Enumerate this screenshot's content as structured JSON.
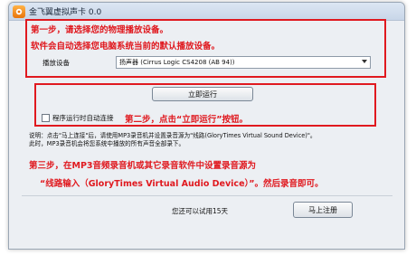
{
  "window": {
    "title": "金飞翼虚拟声卡 0.0"
  },
  "step1": {
    "line1": "第一步，请选择您的物理播放设备。",
    "line2": "软件会自动选择您电脑系统当前的默认播放设备。",
    "device_label": "播放设备",
    "device_value": "扬声器 (Cirrus Logic CS4208 (AB 94))"
  },
  "step2": {
    "run_button": "立即运行",
    "autostart_label": "程序运行时自动连接",
    "instruction": "第二步，点击“立即运行”按钮。"
  },
  "note": {
    "line1": "说明：点击\"马上连接\"后，请使用MP3录音机并设置录音源为\"线路(GloryTimes Virtual Sound Device)\"。",
    "line2": "此时，MP3录音机会将您系统中播放的所有声音全部录下。"
  },
  "step3": {
    "line1": "第三步，在MP3音频录音机或其它录音软件中设置录音源为",
    "line2": "“线路输入（GloryTimes Virtual Audio Device）”。然后录音即可。"
  },
  "footer": {
    "trial_text": "您还可以试用15天",
    "register_button": "马上注册"
  },
  "colors": {
    "accent_red": "#e0191f"
  }
}
